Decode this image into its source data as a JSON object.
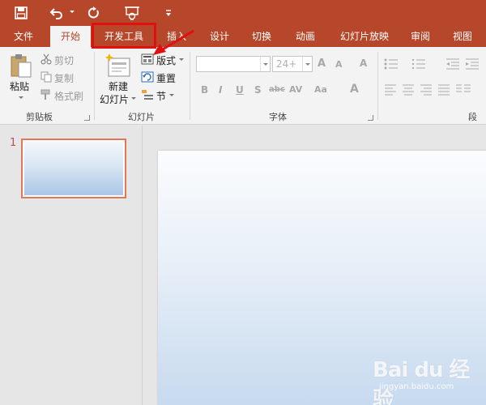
{
  "tabs": [
    {
      "label": "文件"
    },
    {
      "label": "开始"
    },
    {
      "label": "开发工具"
    },
    {
      "label": "插入"
    },
    {
      "label": "设计"
    },
    {
      "label": "切换"
    },
    {
      "label": "动画"
    },
    {
      "label": "幻灯片放映"
    },
    {
      "label": "审阅"
    },
    {
      "label": "视图"
    }
  ],
  "active_tab": "开始",
  "clipboard": {
    "paste": "粘贴",
    "cut": "剪切",
    "copy": "复制",
    "format_painter": "格式刷",
    "group_label": "剪贴板"
  },
  "slides_group": {
    "new_slide_line1": "新建",
    "new_slide_line2": "幻灯片",
    "layout": "版式",
    "reset": "重置",
    "section": "节",
    "group_label": "幻灯片"
  },
  "font": {
    "font_name_value": "",
    "font_size_value": "24+",
    "grow_glyph": "A",
    "shrink_glyph": "A",
    "clear_glyph": "A",
    "bold": "B",
    "italic": "I",
    "underline": "U",
    "shadow": "S",
    "strike": "abc",
    "spacing": "AV",
    "case": "Aa",
    "color_glyph": "A",
    "group_label": "字体"
  },
  "paragraph": {
    "group_label": "段"
  },
  "thumbnail": {
    "slide_number": "1"
  },
  "watermark": {
    "main": "Bai du 经验",
    "sub": "jingyan.baidu.com"
  },
  "colors": {
    "accent": "#b7472a",
    "highlight": "#e01010",
    "thumb_border": "#e0775a"
  },
  "icons": [
    "save-icon",
    "undo-icon",
    "redo-icon",
    "present-icon",
    "customize-icon",
    "paste-icon",
    "cut-icon",
    "copy-icon",
    "format-painter-icon",
    "new-slide-icon",
    "layout-icon",
    "reset-icon",
    "section-icon",
    "bullets-icon",
    "numbering-icon",
    "align-left-icon",
    "align-center-icon",
    "align-right-icon",
    "justify-icon"
  ]
}
